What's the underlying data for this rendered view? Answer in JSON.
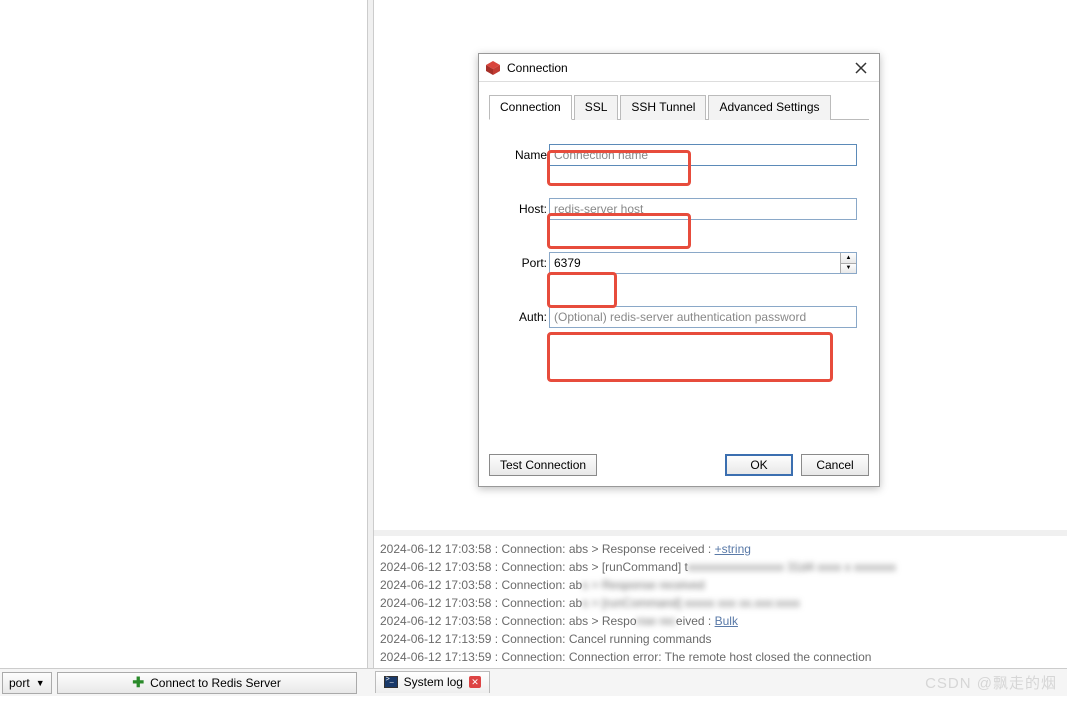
{
  "dialog": {
    "title": "Connection",
    "tabs": [
      "Connection",
      "SSL",
      "SSH Tunnel",
      "Advanced Settings"
    ],
    "active_tab": 0,
    "fields": {
      "name_label": "Name",
      "name_placeholder": "Connection name",
      "host_label": "Host:",
      "host_placeholder": "redis-server host",
      "port_label": "Port:",
      "port_value": "6379",
      "auth_label": "Auth:",
      "auth_placeholder": "(Optional) redis-server authentication password"
    },
    "buttons": {
      "test": "Test Connection",
      "ok": "OK",
      "cancel": "Cancel"
    }
  },
  "log": {
    "lines": [
      {
        "ts": "2024-06-12 17:03:58",
        "text": " : Connection: abs > Response received : ",
        "link": "+string"
      },
      {
        "ts": "2024-06-12 17:03:58",
        "text": " : Connection: abs > [runCommand] t",
        "blur": "xxxxxxxxxxxxxxxx   31d4  xxxx x xxxxxxx"
      },
      {
        "ts": "2024-06-12 17:03:58",
        "text": " : Connection: ab",
        "blur": "s > Response received"
      },
      {
        "ts": "2024-06-12 17:03:58",
        "text": " : Connection: ab",
        "blur": "s > [runCommand]  xxxxx   xxx        xx.xxx:xxxx"
      },
      {
        "ts": "2024-06-12 17:03:58",
        "text": " : Connection: abs > Respo",
        "blur": "nse rec",
        "text2": "eived : ",
        "link": "Bulk"
      },
      {
        "ts": "2024-06-12 17:13:59",
        "text": " : Connection: Cancel running commands"
      },
      {
        "ts": "2024-06-12 17:13:59",
        "text": " : Connection: Connection error: The remote host closed the connection"
      }
    ]
  },
  "bottom": {
    "export": "port",
    "connect": "Connect to Redis Server",
    "syslog": "System log"
  },
  "watermark": "CSDN @飘走的烟"
}
